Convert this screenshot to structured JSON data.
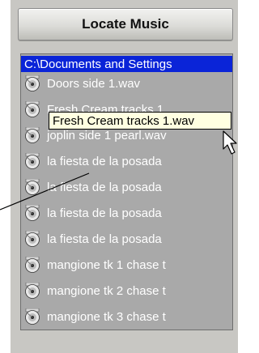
{
  "locate_button": {
    "label": "Locate Music"
  },
  "file_list": {
    "path": "C:\\Documents and Settings",
    "items": [
      {
        "label": "Doors side 1.wav",
        "icon": "cd-icon"
      },
      {
        "label": "Fresh Cream tracks 1",
        "icon": "cd-icon"
      },
      {
        "label": "joplin side 1 pearl.wav",
        "icon": "cd-icon"
      },
      {
        "label": "la fiesta de la posada",
        "icon": "cd-icon"
      },
      {
        "label": "la fiesta de la posada",
        "icon": "cd-icon"
      },
      {
        "label": "la fiesta de la posada",
        "icon": "cd-icon"
      },
      {
        "label": "la fiesta de la posada",
        "icon": "cd-icon"
      },
      {
        "label": "mangione tk 1 chase t",
        "icon": "cd-icon"
      },
      {
        "label": "mangione tk 2 chase t",
        "icon": "cd-icon"
      },
      {
        "label": "mangione tk 3 chase t",
        "icon": "cd-icon"
      }
    ]
  },
  "tooltip": {
    "text": "Fresh Cream tracks 1.wav"
  },
  "colors": {
    "selection": "#0a24d8",
    "list_background": "#a9a9a9",
    "tooltip_background": "#ffffe1"
  }
}
